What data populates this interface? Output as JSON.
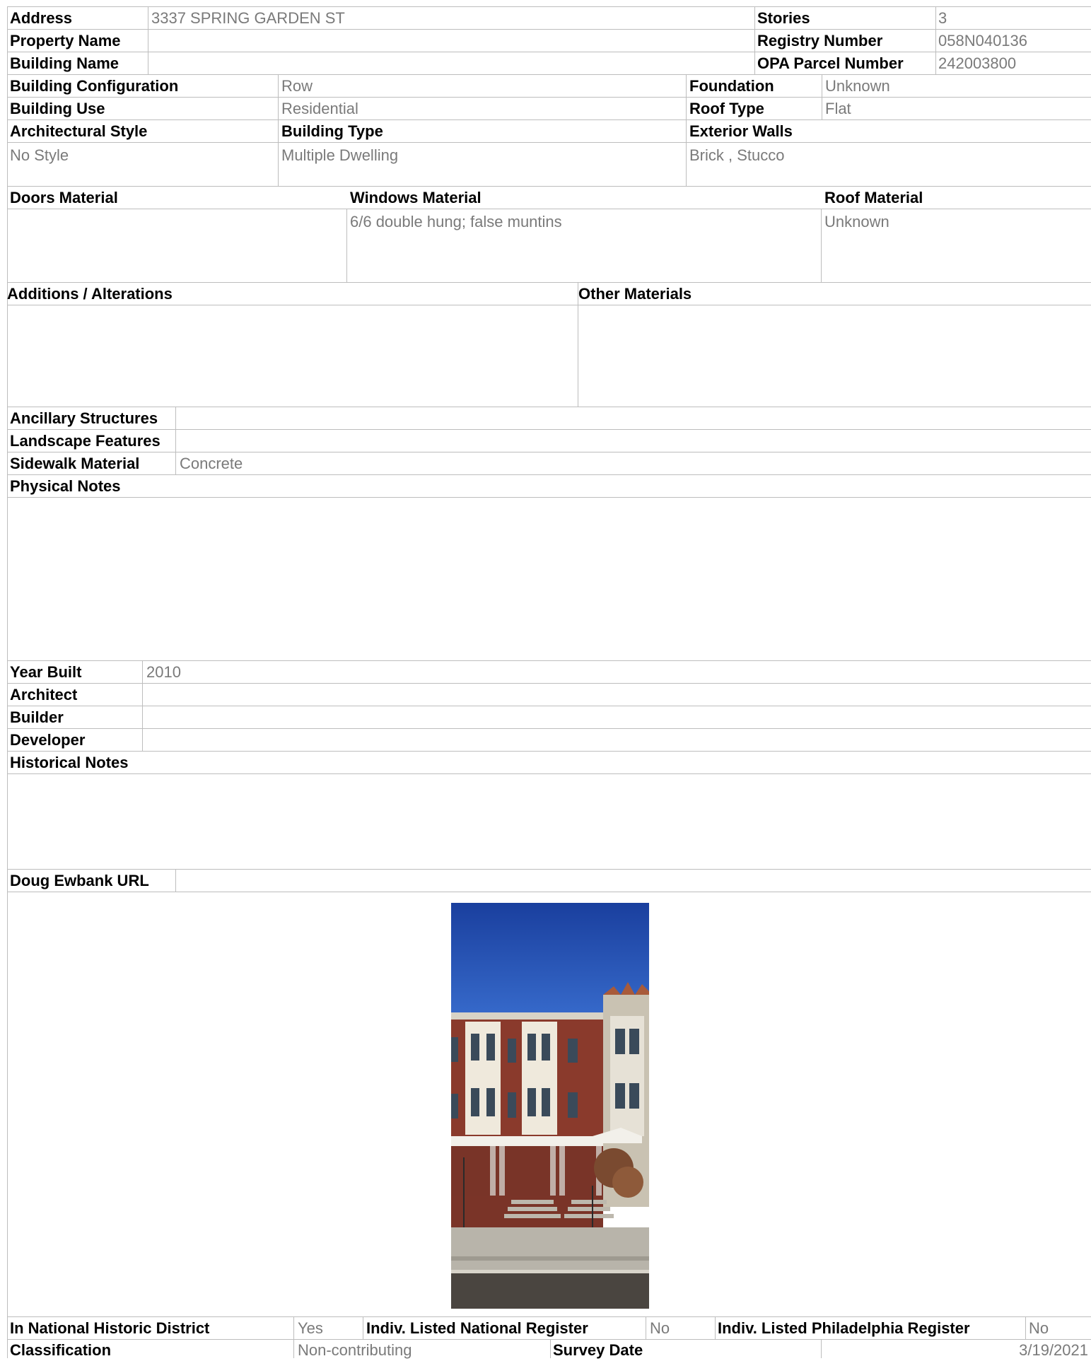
{
  "header": {
    "address_label": "Address",
    "address_value": "3337 SPRING GARDEN ST",
    "stories_label": "Stories",
    "stories_value": "3",
    "property_name_label": "Property Name",
    "property_name_value": "",
    "registry_number_label": "Registry Number",
    "registry_number_value": "058N040136",
    "building_name_label": "Building Name",
    "building_name_value": "",
    "opa_label": "OPA Parcel Number",
    "opa_value": "242003800"
  },
  "building": {
    "configuration_label": "Building Configuration",
    "configuration_value": "Row",
    "foundation_label": "Foundation",
    "foundation_value": "Unknown",
    "use_label": "Building Use",
    "use_value": "Residential",
    "roof_type_label": "Roof Type",
    "roof_type_value": "Flat",
    "style_label": "Architectural Style",
    "style_value": "No Style",
    "type_label": "Building Type",
    "type_value": "Multiple Dwelling",
    "walls_label": "Exterior Walls",
    "walls_value": "Brick , Stucco"
  },
  "materials": {
    "doors_label": "Doors Material",
    "doors_value": "",
    "windows_label": "Windows Material",
    "windows_value": "6/6 double hung; false muntins",
    "roof_label": "Roof Material",
    "roof_value": "Unknown",
    "additions_label": "Additions / Alterations",
    "additions_value": "",
    "other_label": "Other Materials",
    "other_value": ""
  },
  "site": {
    "ancillary_label": "Ancillary Structures",
    "ancillary_value": "",
    "landscape_label": "Landscape Features",
    "landscape_value": "",
    "sidewalk_label": "Sidewalk Material",
    "sidewalk_value": "Concrete",
    "physical_notes_label": "Physical Notes",
    "physical_notes_value": ""
  },
  "history": {
    "year_label": "Year Built",
    "year_value": "2010",
    "architect_label": "Architect",
    "architect_value": "",
    "builder_label": "Builder",
    "builder_value": "",
    "developer_label": "Developer",
    "developer_value": "",
    "notes_label": "Historical Notes",
    "notes_value": "",
    "url_label": "Doug Ewbank URL",
    "url_value": ""
  },
  "status": {
    "district_label": "In National Historic District",
    "district_value": "Yes",
    "national_label": "Indiv. Listed National Register",
    "national_value": "No",
    "philly_label": "Indiv. Listed Philadelphia Register",
    "philly_value": "No",
    "classification_label": "Classification",
    "classification_value": "Non-contributing",
    "survey_label": "Survey Date",
    "survey_value": "3/19/2021"
  },
  "colors": {
    "sky": "#1f4fb0",
    "brick": "#8a3a2c",
    "trim": "#f2f0ea",
    "sidewalk": "#b8b4aa",
    "street": "#4a4540"
  }
}
